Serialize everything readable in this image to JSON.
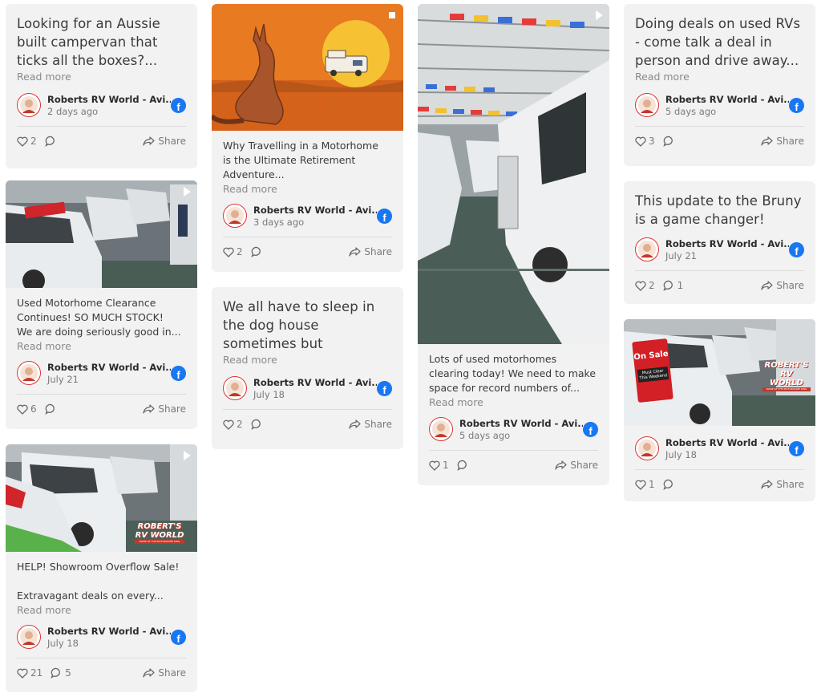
{
  "author_name": "Roberts RV World - Avi...",
  "read_more": "Read more",
  "share_label": "Share",
  "colors": {
    "card_bg": "#f2f2f2",
    "facebook": "#1877f2",
    "text": "#3a3a3a",
    "muted": "#8a8a8a"
  },
  "cards": [
    {
      "text": "Looking for an Aussie built campervan that ticks all the boxes?...",
      "date": "2 days ago",
      "likes": "2",
      "comments": ""
    },
    {
      "text_lines": [
        "Used Motorhome Clearance",
        "Continues! SO MUCH STOCK!",
        "We are doing seriously good in..."
      ],
      "date": "July 21",
      "likes": "6",
      "comments": ""
    },
    {
      "text_lines": [
        "HELP! Showroom Overflow Sale!",
        "",
        "Extravagant deals on every..."
      ],
      "date": "July 18",
      "likes": "21",
      "comments": "5",
      "overlay": [
        "ROBERT'S",
        "RV WORLD",
        "HOME OF THE MOTORHOME KING"
      ]
    },
    {
      "text_lines": [
        "Why Travelling in a Motorhome",
        "is the Ultimate Retirement",
        "Adventure..."
      ],
      "date": "3 days ago",
      "likes": "2",
      "comments": ""
    },
    {
      "text": "We all have to sleep in the dog house sometimes but sleeping...",
      "date": "July 18",
      "likes": "2",
      "comments": ""
    },
    {
      "text_lines": [
        "Lots of used motorhomes",
        "clearing today! We need to make",
        "space for record numbers of..."
      ],
      "date": "5 days ago",
      "likes": "1",
      "comments": ""
    },
    {
      "text": "Doing deals on used RVs - come talk a deal in person and drive away...",
      "date": "5 days ago",
      "likes": "3",
      "comments": ""
    },
    {
      "text": "This update to the Bruny is a game changer!",
      "date": "July 21",
      "likes": "2",
      "comments": "1"
    },
    {
      "date": "July 18",
      "likes": "1",
      "comments": "",
      "overlay": [
        "On Sale",
        "Must Clear This Weekend",
        "ROBERT'S",
        "RV WORLD",
        "HOME OF THE MOTORHOME KING"
      ]
    }
  ]
}
